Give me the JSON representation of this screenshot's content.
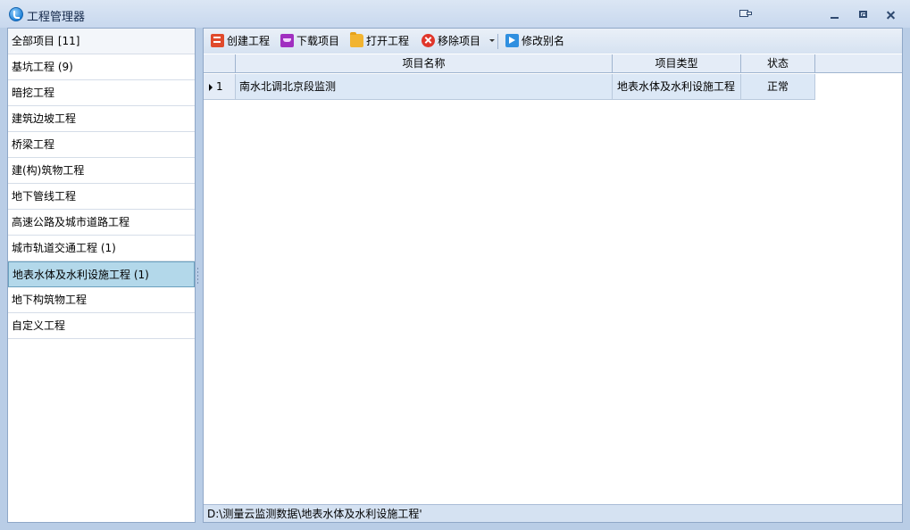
{
  "window": {
    "title": "工程管理器"
  },
  "sidebar": {
    "items": [
      {
        "label": "全部项目 [11]"
      },
      {
        "label": "基坑工程 (9)"
      },
      {
        "label": "暗挖工程"
      },
      {
        "label": "建筑边坡工程"
      },
      {
        "label": "桥梁工程"
      },
      {
        "label": "建(构)筑物工程"
      },
      {
        "label": "地下管线工程"
      },
      {
        "label": "高速公路及城市道路工程"
      },
      {
        "label": "城市轨道交通工程 (1)"
      },
      {
        "label": "地表水体及水利设施工程 (1)"
      },
      {
        "label": "地下构筑物工程"
      },
      {
        "label": "自定义工程"
      }
    ],
    "selected_index": 9
  },
  "toolbar": {
    "create": "创建工程",
    "download": "下载项目",
    "open": "打开工程",
    "remove": "移除项目",
    "rename": "修改别名"
  },
  "grid": {
    "columns": [
      "项目名称",
      "项目类型",
      "状态"
    ],
    "rows": [
      {
        "index": "1",
        "name": "南水北调北京段监测",
        "type": "地表水体及水利设施工程",
        "status": "正常"
      }
    ]
  },
  "statusbar": {
    "path": "D:\\测量云监测数据\\地表水体及水利设施工程'"
  }
}
